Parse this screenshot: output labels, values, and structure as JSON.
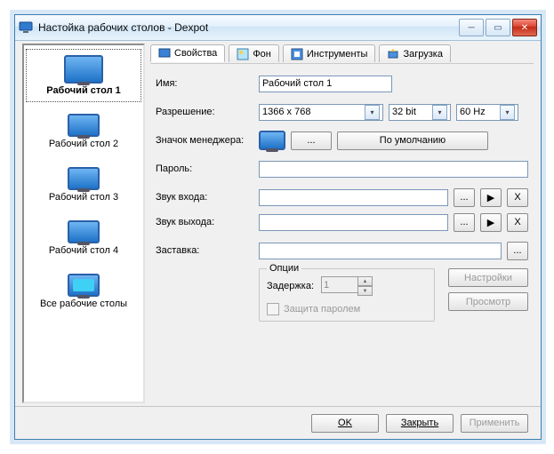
{
  "window": {
    "title": "Настойка рабочих столов - Dexpot"
  },
  "sidebar": {
    "items": [
      {
        "label": "Рабочий стол 1"
      },
      {
        "label": "Рабочий стол 2"
      },
      {
        "label": "Рабочий стол 3"
      },
      {
        "label": "Рабочий стол 4"
      },
      {
        "label": "Все рабочие столы"
      }
    ]
  },
  "tabs": [
    {
      "label": "Свойства"
    },
    {
      "label": "Фон"
    },
    {
      "label": "Инструменты"
    },
    {
      "label": "Загрузка"
    }
  ],
  "form": {
    "name_label": "Имя:",
    "name_value": "Рабочий стол 1",
    "resolution_label": "Разрешение:",
    "resolution_value": "1366 x 768",
    "color_value": "32 bit",
    "refresh_value": "60 Hz",
    "icon_label": "Значок менеджера:",
    "icon_browse": "...",
    "icon_default": "По умолчанию",
    "password_label": "Пароль:",
    "password_value": "",
    "sound_in_label": "Звук входа:",
    "sound_out_label": "Звук выхода:",
    "sound_browse": "...",
    "sound_play": "▶",
    "sound_clear": "X",
    "screensaver_label": "Заставка:",
    "screensaver_browse": "...",
    "group_title": "Опции",
    "delay_label": "Задержка:",
    "delay_value": "1",
    "protect_label": "Защита паролем",
    "settings_btn": "Настройки",
    "preview_btn": "Просмотр"
  },
  "footer": {
    "ok": "OK",
    "close": "Закрыть",
    "apply": "Применить"
  }
}
